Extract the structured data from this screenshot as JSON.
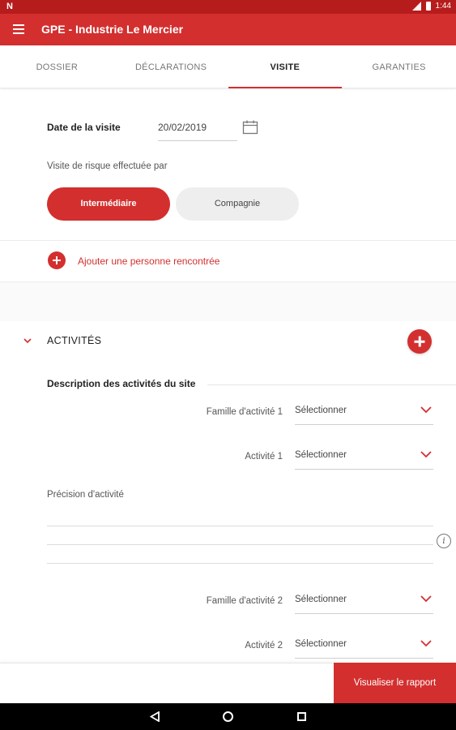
{
  "status_bar": {
    "notification_letter": "N",
    "time": "1:44"
  },
  "app_bar": {
    "title": "GPE - Industrie Le Mercier"
  },
  "tabs": [
    {
      "label": "DOSSIER",
      "active": false
    },
    {
      "label": "DÉCLARATIONS",
      "active": false
    },
    {
      "label": "VISITE",
      "active": true
    },
    {
      "label": "GARANTIES",
      "active": false
    }
  ],
  "visit": {
    "date_label": "Date de la visite",
    "date_value": "20/02/2019",
    "performed_by_label": "Visite de risque effectuée par",
    "options": {
      "selected": "Intermédiaire",
      "other": "Compagnie"
    },
    "add_person_label": "Ajouter une personne rencontrée"
  },
  "activities": {
    "section_title": "ACTIVITÉS",
    "description_title": "Description des activités du site",
    "fields": [
      {
        "label": "Famille d'activité 1",
        "value": "Sélectionner"
      },
      {
        "label": "Activité 1",
        "value": "Sélectionner"
      },
      {
        "label": "Famille d'activité 2",
        "value": "Sélectionner"
      },
      {
        "label": "Activité 2",
        "value": "Sélectionner"
      }
    ],
    "precision_label": "Précision d'activité",
    "info_symbol": "i"
  },
  "footer": {
    "report_button": "Visualiser le rapport"
  },
  "colors": {
    "primary": "#d32f2f",
    "status_bar": "#b71c1c"
  }
}
